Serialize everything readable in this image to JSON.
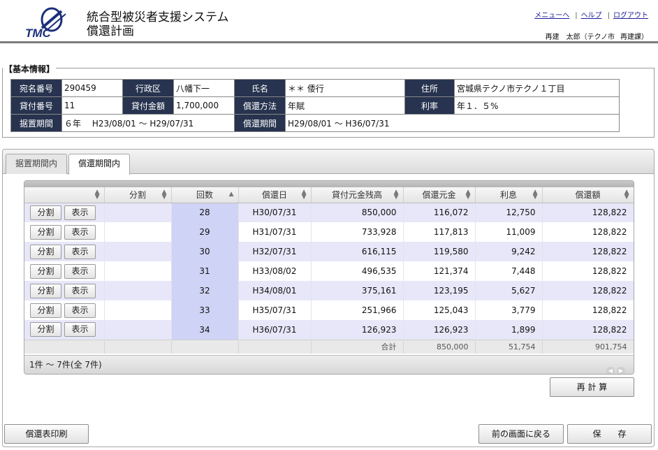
{
  "header": {
    "system_title": "統合型被災者支援システム",
    "page_title": "償還計画",
    "logo_text": "TMC",
    "links": [
      "メニューへ",
      "ヘルプ",
      "ログアウト"
    ],
    "user_name": "再建　太郎（テクノ市",
    "user_dept": "再建課）"
  },
  "basic_info": {
    "legend": "【基本情報】",
    "row1": {
      "l1": "宛名番号",
      "v1": "290459",
      "l2": "行政区",
      "v2": "八幡下一",
      "l3": "氏名",
      "v3": "＊＊ 倭行",
      "l4": "住所",
      "v4": "宮城県テクノ市テクノ１丁目"
    },
    "row2": {
      "l1": "貸付番号",
      "v1": "11",
      "l2": "貸付金額",
      "v2": "1,700,000",
      "l3": "償還方法",
      "v3": "年賦",
      "l4": "利率",
      "v4": "年１．５%"
    },
    "row3": {
      "l1": "据置期間",
      "v1": "６年　 H23/08/01 ～ H29/07/31",
      "l3": "償還期間",
      "v3": "H29/08/01 ～ H36/07/31"
    }
  },
  "tabs": [
    {
      "label": "据置期間内",
      "active": false
    },
    {
      "label": "償還期間内",
      "active": true
    }
  ],
  "grid": {
    "columns": [
      "",
      "分割",
      "回数",
      "償還日",
      "貸付元金残高",
      "償還元金",
      "利息",
      "償還額"
    ],
    "button_split": "分割",
    "button_show": "表示",
    "rows": [
      {
        "count": "28",
        "date": "H30/07/31",
        "balance": "850,000",
        "principal": "116,072",
        "interest": "12,750",
        "payment": "128,822"
      },
      {
        "count": "29",
        "date": "H31/07/31",
        "balance": "733,928",
        "principal": "117,813",
        "interest": "11,009",
        "payment": "128,822"
      },
      {
        "count": "30",
        "date": "H32/07/31",
        "balance": "616,115",
        "principal": "119,580",
        "interest": "9,242",
        "payment": "128,822"
      },
      {
        "count": "31",
        "date": "H33/08/02",
        "balance": "496,535",
        "principal": "121,374",
        "interest": "7,448",
        "payment": "128,822"
      },
      {
        "count": "32",
        "date": "H34/08/01",
        "balance": "375,161",
        "principal": "123,195",
        "interest": "5,627",
        "payment": "128,822"
      },
      {
        "count": "33",
        "date": "H35/07/31",
        "balance": "251,966",
        "principal": "125,043",
        "interest": "3,779",
        "payment": "128,822"
      },
      {
        "count": "34",
        "date": "H36/07/31",
        "balance": "126,923",
        "principal": "126,923",
        "interest": "1,899",
        "payment": "128,822"
      }
    ],
    "total": {
      "label": "合計",
      "principal": "850,000",
      "interest": "51,754",
      "payment": "901,754"
    },
    "pager_text": "1件 ～ 7件(全 7件)"
  },
  "buttons": {
    "recalc": "再 計 算",
    "print": "償還表印刷",
    "back": "前の画面に戻る",
    "save": "保　　存"
  },
  "colors": {
    "label_bg": "#27334f",
    "row_odd": "#e7e7f9",
    "count_col": "#cfd3f5"
  }
}
